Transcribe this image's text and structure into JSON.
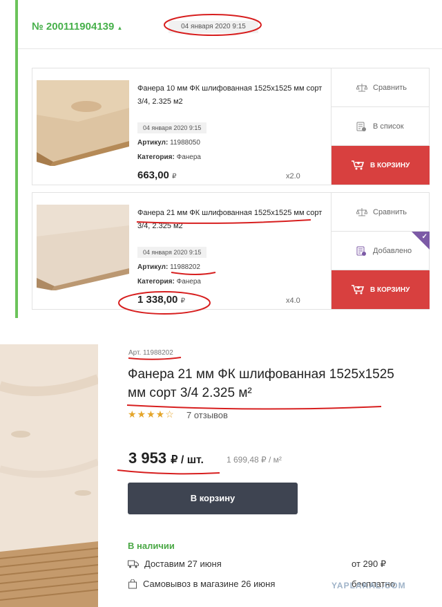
{
  "order": {
    "number": "№ 200111904139",
    "toggle_icon": "caret-up-icon",
    "date": "04 января 2020 9:15"
  },
  "order_items": [
    {
      "title": "Фанера 10 мм ФК шлифованная 1525х1525 мм сорт 3/4, 2.325 м2",
      "date": "04 января 2020 9:15",
      "article_label": "Артикул:",
      "article": "11988050",
      "category_label": "Категория:",
      "category": "Фанера",
      "price": "663,00",
      "currency": "₽",
      "qty": "x2.0",
      "compare_label": "Сравнить",
      "list_label": "В список",
      "cart_label": "В КОРЗИНУ"
    },
    {
      "title": "Фанера 21 мм ФК шлифованная 1525х1525 мм сорт 3/4, 2.325 м2",
      "date": "04 января 2020 9:15",
      "article_label": "Артикул:",
      "article": "11988202",
      "category_label": "Категория:",
      "category": "Фанера",
      "price": "1 338,00",
      "currency": "₽",
      "qty": "x4.0",
      "compare_label": "Сравнить",
      "list_label": "Добавлено",
      "cart_label": "В КОРЗИНУ"
    }
  ],
  "product": {
    "article": "Арт. 11988202",
    "title": "Фанера 21 мм ФК шлифованная 1525х1525 мм сорт 3/4 2.325 м²",
    "stars": "★★★★☆",
    "rating": 3.5,
    "reviews": "7 отзывов",
    "price": "3 953",
    "price_unit": "₽ / шт.",
    "price_per_m2": "1 699,48 ₽ / м²",
    "buy_label": "В корзину",
    "stock": "В наличии",
    "delivery_label": "Доставим 27 июня",
    "delivery_price": "от 290 ₽",
    "pickup_label": "Самовывоз в магазине 26 июня",
    "pickup_price": "бесплатно"
  },
  "watermark": "YAPLAKAL.COM",
  "colors": {
    "accent_green": "#47b04b",
    "cart_red": "#d8403f",
    "buy_dark": "#3e4451",
    "marker_red": "#d71e1e",
    "added_badge": "#7c5aa6"
  }
}
